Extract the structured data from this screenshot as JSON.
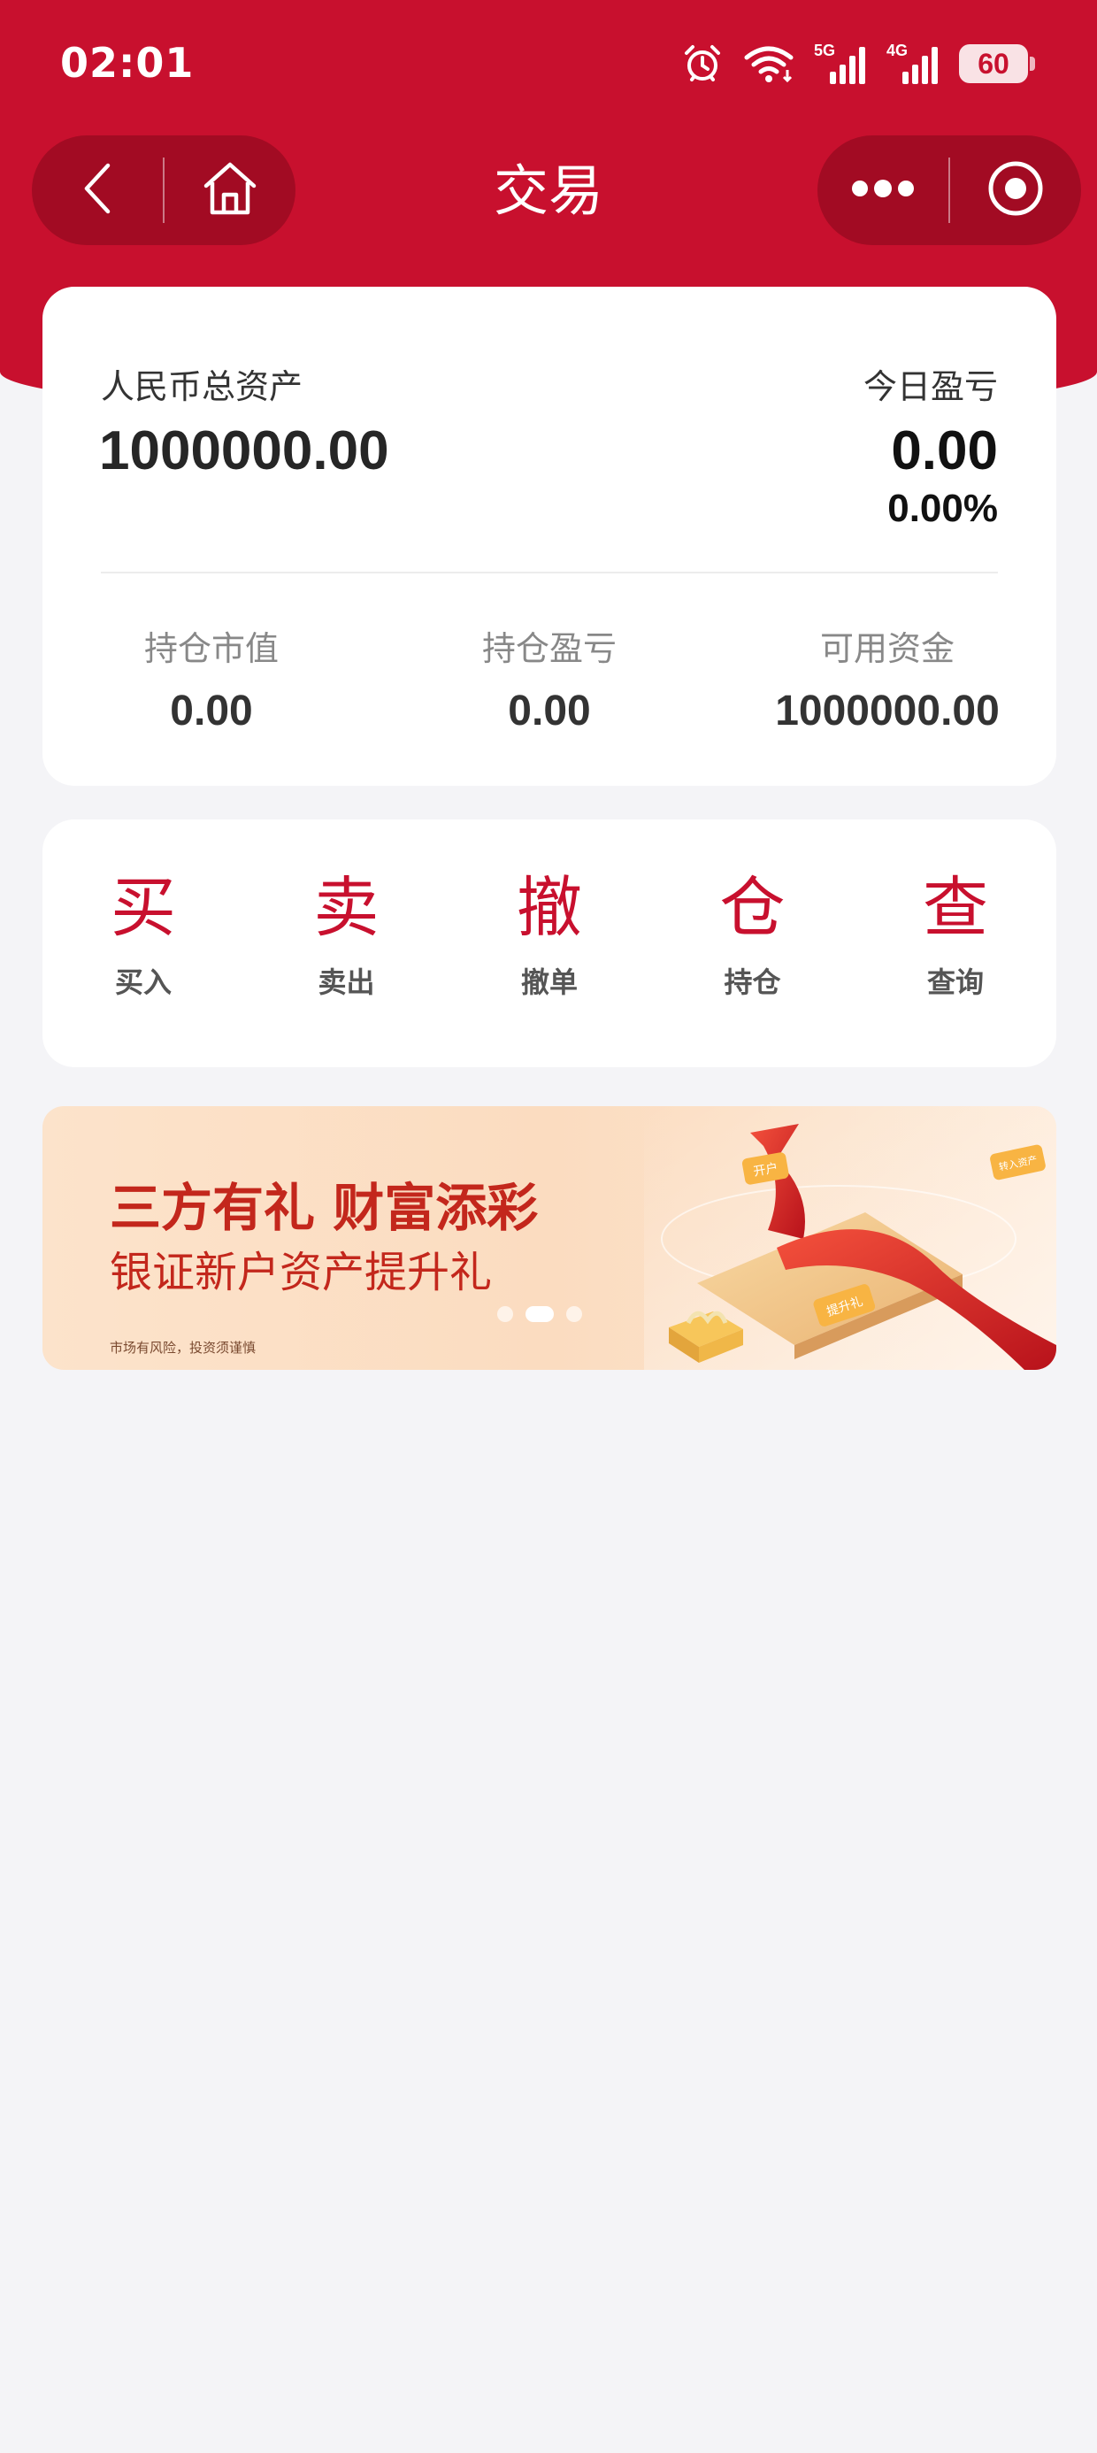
{
  "status_bar": {
    "time": "02:01",
    "signal_1": "5G",
    "signal_2": "4G",
    "battery": "60"
  },
  "nav": {
    "title": "交易"
  },
  "assets": {
    "total_label": "人民币总资产",
    "total_value": "1000000.00",
    "pnl_label": "今日盈亏",
    "pnl_value": "0.00",
    "pnl_percent": "0.00%",
    "stats": [
      {
        "label": "持仓市值",
        "value": "0.00"
      },
      {
        "label": "持仓盈亏",
        "value": "0.00"
      },
      {
        "label": "可用资金",
        "value": "1000000.00"
      }
    ]
  },
  "actions": [
    {
      "glyph": "买",
      "label": "买入"
    },
    {
      "glyph": "卖",
      "label": "卖出"
    },
    {
      "glyph": "撤",
      "label": "撤单"
    },
    {
      "glyph": "仓",
      "label": "持仓"
    },
    {
      "glyph": "查",
      "label": "查询"
    }
  ],
  "banner": {
    "title": "三方有礼 财富添彩",
    "subtitle": "银证新户资产提升礼",
    "disclaimer": "市场有风险，投资须谨慎",
    "tag_1": "开户",
    "tag_2": "提升礼",
    "tag_3": "转入资产",
    "slide_count": 3,
    "active_slide": 2
  },
  "colors": {
    "brand_red": "#c8102e",
    "capsule_red": "#a20b23",
    "page_bg": "#f4f4f7",
    "banner_text": "#c3271c"
  },
  "icons": {
    "back": "chevron-left-icon",
    "home": "home-icon",
    "more": "more-dots-icon",
    "close": "target-icon",
    "alarm": "alarm-icon",
    "wifi": "wifi-icon"
  }
}
